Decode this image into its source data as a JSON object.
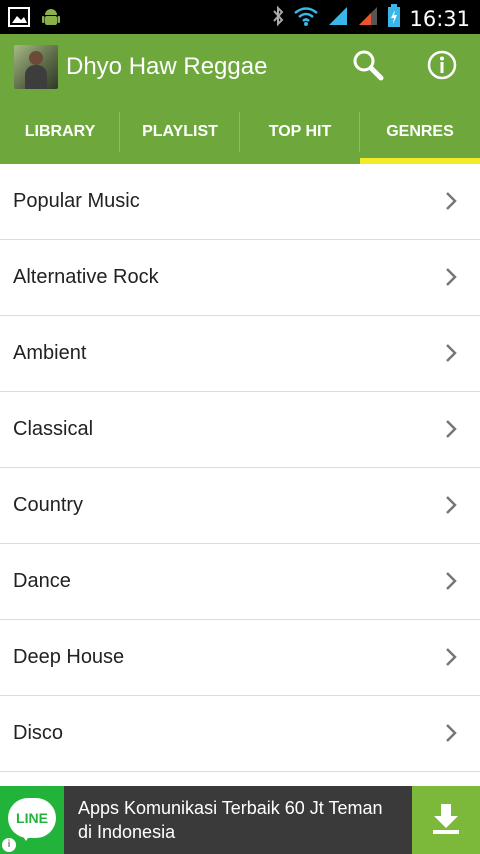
{
  "status_bar": {
    "time": "16:31",
    "icons": [
      "gallery-icon",
      "android-icon",
      "bluetooth-icon",
      "wifi-icon",
      "signal-icon",
      "signal-2-icon",
      "battery-charging-icon"
    ]
  },
  "app_bar": {
    "title": "Dhyo Haw Reggae",
    "icons": [
      "search-icon",
      "info-icon"
    ]
  },
  "tabs": [
    {
      "label": "LIBRARY",
      "active": false
    },
    {
      "label": "PLAYLIST",
      "active": false
    },
    {
      "label": "TOP HIT",
      "active": false
    },
    {
      "label": "GENRES",
      "active": true
    }
  ],
  "genres": [
    "Popular Music",
    "Alternative Rock",
    "Ambient",
    "Classical",
    "Country",
    "Dance",
    "Deep House",
    "Disco"
  ],
  "ad": {
    "logo_text": "LINE",
    "text": "Apps Komunikasi Terbaik 60 Jt Teman di Indonesia",
    "info_glyph": "i"
  },
  "colors": {
    "primary": "#6ea83c",
    "tab_indicator": "#f3ea28",
    "line_green": "#22b43a",
    "ad_background": "#3a3a3a"
  }
}
